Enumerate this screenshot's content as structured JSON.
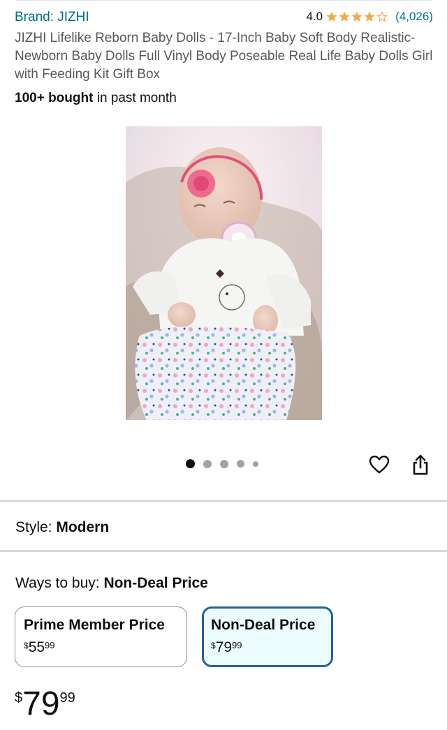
{
  "header": {
    "brand": "Brand: JIZHI",
    "rating_value": "4.0",
    "rating_stars": 4,
    "rating_count": "(4,026)"
  },
  "product": {
    "title": "JIZHI Lifelike Reborn Baby Dolls - 17-Inch Baby Soft Body Realistic-Newborn Baby Dolls Full Vinyl Body Poseable Real Life Baby Dolls Girl with Feeding Kit Gift Box",
    "bought_bold": "100+ bought",
    "bought_rest": " in past month"
  },
  "gallery": {
    "image_count": 5,
    "active_index": 0
  },
  "style": {
    "label": "Style: ",
    "value": "Modern"
  },
  "ways_to_buy": {
    "label": "Ways to buy: ",
    "selected": "Non-Deal Price",
    "options": [
      {
        "title": "Prime Member Price",
        "currency": "$",
        "whole": "55",
        "cents": "99"
      },
      {
        "title": "Non-Deal Price",
        "currency": "$",
        "whole": "79",
        "cents": "99"
      }
    ]
  },
  "price": {
    "currency": "$",
    "whole": "79",
    "cents": "99"
  },
  "colors": {
    "link": "#007185",
    "star": "#f3a847",
    "selected_border": "#2162a1",
    "selected_bg": "#edfdff"
  }
}
